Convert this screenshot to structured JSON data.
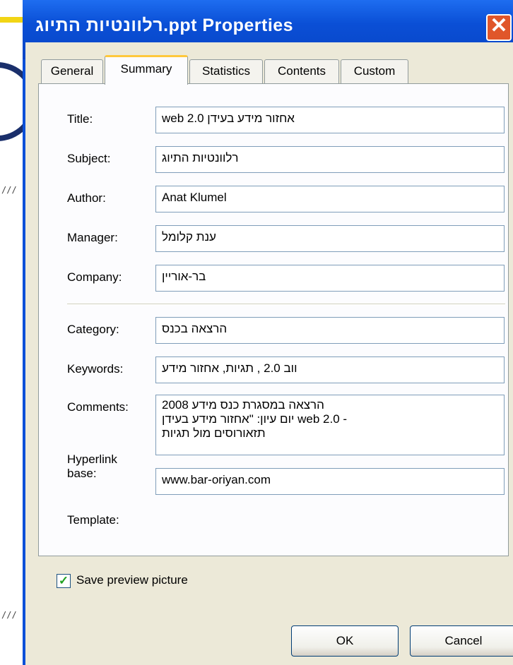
{
  "window": {
    "title": "רלוונטיות התיוג.ppt Properties",
    "close_glyph": "✕"
  },
  "tabs": [
    {
      "label": "General"
    },
    {
      "label": "Summary"
    },
    {
      "label": "Statistics"
    },
    {
      "label": "Contents"
    },
    {
      "label": "Custom"
    }
  ],
  "active_tab": "Summary",
  "fields": {
    "title": {
      "label": "Title:",
      "value": "אחזור מידע בעידן web 2.0"
    },
    "subject": {
      "label": "Subject:",
      "value": "רלוונטיות התיוג"
    },
    "author": {
      "label": "Author:",
      "value": "Anat Klumel"
    },
    "manager": {
      "label": "Manager:",
      "value": "ענת קלומל"
    },
    "company": {
      "label": "Company:",
      "value": "בר-אוריין"
    },
    "category": {
      "label": "Category:",
      "value": "הרצאה בכנס"
    },
    "keywords": {
      "label": "Keywords:",
      "value": "ווב 2.0 , תגיות, אחזור מידע"
    },
    "comments": {
      "label": "Comments:",
      "lines": [
        "הרצאה במסגרת כנס מידע 2008",
        "יום עיון: \"אחזור מידע בעידן web 2.0 -",
        "תזאורוסים מול תגיות"
      ]
    },
    "hyperlink_base": {
      "label_line1": "Hyperlink",
      "label_line2": "base:",
      "value": "www.bar-oriyan.com"
    },
    "template": {
      "label": "Template:"
    }
  },
  "save_preview": {
    "label": "Save preview picture",
    "checked": true
  },
  "buttons": {
    "ok": "OK",
    "cancel": "Cancel"
  },
  "colors": {
    "titlebar": "#0a50d8",
    "dialog_bg": "#ece9d8",
    "active_tab_accent": "#ffc83c",
    "close_button": "#e0562a"
  }
}
